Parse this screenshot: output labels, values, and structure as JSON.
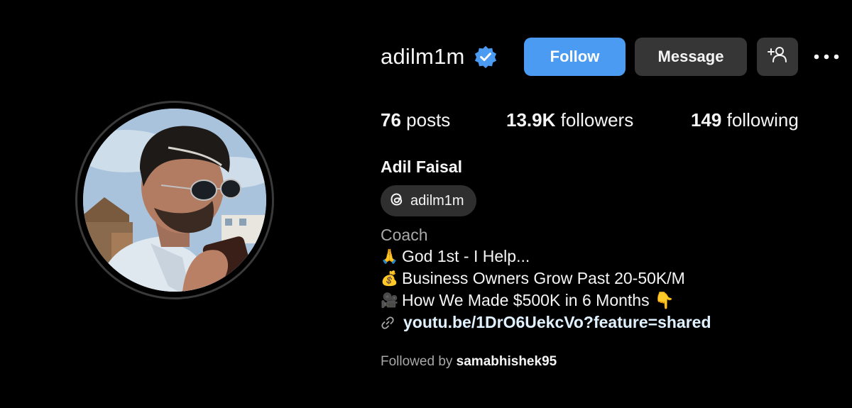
{
  "profile": {
    "username": "adilm1m",
    "verified": true,
    "full_name": "Adil Faisal",
    "threads_handle": "adilm1m",
    "category": "Coach"
  },
  "actions": {
    "follow_label": "Follow",
    "message_label": "Message",
    "add_user_icon": "person-plus-icon",
    "more_icon": "more-horizontal-icon"
  },
  "stats": {
    "posts_count": "76",
    "posts_label": "posts",
    "followers_count": "13.9K",
    "followers_label": "followers",
    "following_count": "149",
    "following_label": "following"
  },
  "bio": {
    "lines": [
      {
        "emoji": "🙏",
        "text": "God 1st - I Help..."
      },
      {
        "emoji": "💰",
        "text": "Business Owners Grow Past 20-50K/M"
      },
      {
        "emoji": "🎥",
        "text": "How We Made $500K in 6 Months 👇"
      }
    ],
    "link": "youtu.be/1DrO6UekcVo?feature=shared"
  },
  "followed_by": {
    "prefix": "Followed by",
    "user": "samabhishek95"
  },
  "colors": {
    "background": "#000000",
    "follow_button": "#4a9bf1",
    "secondary_button": "#363636",
    "verified_badge": "#4a9bf1",
    "muted_text": "#a8a8a8"
  }
}
